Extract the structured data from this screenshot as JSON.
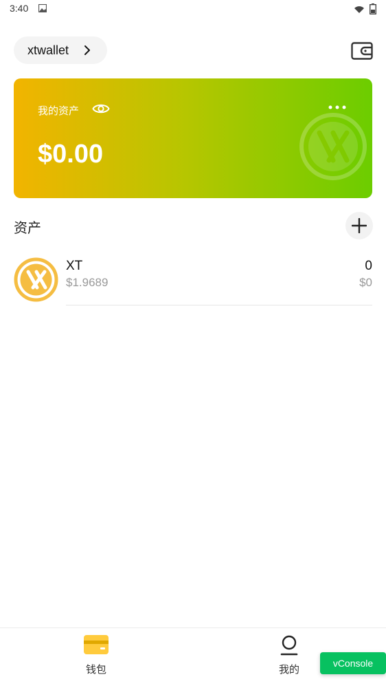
{
  "status_bar": {
    "time": "3:40",
    "icons": [
      "image-icon",
      "wifi-icon",
      "battery-icon"
    ]
  },
  "header": {
    "wallet_name": "xtwallet",
    "chevron_icon": "chevron-right-icon",
    "wallet_icon": "wallet-icon"
  },
  "asset_card": {
    "label": "我的资产",
    "balance": "$0.00",
    "gradient_colors": [
      "#f2b400",
      "#b6c600",
      "#6ccd00"
    ],
    "eye_icon": "eye-icon",
    "more_icon": "more-icon",
    "watermark_icon": "xt-logo-icon"
  },
  "assets_section": {
    "title": "资产",
    "add_icon": "plus-icon",
    "items": [
      {
        "symbol": "XT",
        "price": "$1.9689",
        "amount": "0",
        "value": "$0",
        "logo_icon": "xt-logo-icon",
        "logo_color": "#f5bd42"
      }
    ]
  },
  "tab_bar": {
    "tabs": [
      {
        "label": "钱包",
        "icon": "wallet-card-icon",
        "icon_color": "#ffcb3d"
      },
      {
        "label": "我的",
        "icon": "user-icon"
      }
    ]
  },
  "vconsole": {
    "label": "vConsole",
    "color": "#07c160"
  }
}
